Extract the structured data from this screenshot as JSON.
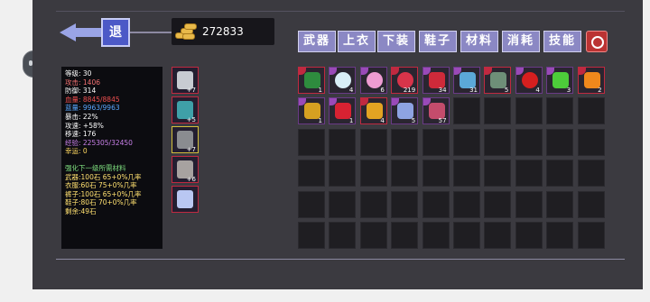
{
  "back_label": "退",
  "gold_amount": "272833",
  "tabs": [
    "武器",
    "上衣",
    "下装",
    "鞋子",
    "材料",
    "消耗",
    "技能"
  ],
  "stats": {
    "level": "等级: 30",
    "attack": "攻击: 1406",
    "defense": "防御: 314",
    "hp": "血量: 8845/8845",
    "mp": "蓝量: 9963/9963",
    "crit": "暴击: 22%",
    "atk_speed": "攻速: +58%",
    "move_speed": "移速: 176",
    "exp": "经验: 225305/32450",
    "luck": "幸运: 0",
    "upgrade_title": "强化下一级所需材料",
    "weapon_req": "武器:100石 65+0%几率",
    "top_req": "衣服:60石 75+0%几率",
    "pants_req": "裤子:100石 65+0%几率",
    "shoes_req": "鞋子:80石 70+0%几率",
    "remaining": "剩余:49石"
  },
  "equipment": [
    {
      "name": "weapon-slot",
      "level": "+7",
      "icon": "sword-icon",
      "color": "#c8cbd2"
    },
    {
      "name": "top-slot",
      "level": "+5",
      "icon": "robe-icon",
      "color": "#3fa0a8"
    },
    {
      "name": "pants-slot",
      "level": "+7",
      "icon": "armor-icon",
      "color": "#8a8c90"
    },
    {
      "name": "shoes-slot",
      "level": "+6",
      "icon": "boot-icon",
      "color": "#a7a2a0"
    },
    {
      "name": "accessory-slot",
      "level": "",
      "icon": "pet-icon",
      "color": "#b9c7f2"
    }
  ],
  "inventory": [
    {
      "icon": "green-book-icon",
      "count": "1",
      "color": "#2e8c3e"
    },
    {
      "icon": "white-orb-icon",
      "count": "4",
      "color": "#d9eef7"
    },
    {
      "icon": "pink-orb-icon",
      "count": "6",
      "color": "#ee9cd2"
    },
    {
      "icon": "red-orb-icon",
      "count": "219",
      "color": "#d8344a"
    },
    {
      "icon": "red-potion-icon",
      "count": "34",
      "color": "#cf2a3a"
    },
    {
      "icon": "blue-potion-icon",
      "count": "31",
      "color": "#5ba8d8"
    },
    {
      "icon": "jar-icon",
      "count": "5",
      "color": "#6e8f78"
    },
    {
      "icon": "red-apple-icon",
      "count": "4",
      "color": "#d61f1f"
    },
    {
      "icon": "green-slime-icon",
      "count": "3",
      "color": "#4dcc3a"
    },
    {
      "icon": "fire-pet-icon",
      "count": "2",
      "color": "#f0881c"
    },
    {
      "icon": "gold-pet-icon",
      "count": "1",
      "color": "#d6a021"
    },
    {
      "icon": "ladybug-icon",
      "count": "1",
      "color": "#d82232"
    },
    {
      "icon": "lantern-icon",
      "count": "4",
      "color": "#e3a322"
    },
    {
      "icon": "crystal-beast-icon",
      "count": "5",
      "color": "#8ea3e2"
    },
    {
      "icon": "fire-beast-icon",
      "count": "57",
      "color": "#c44c6c"
    }
  ]
}
